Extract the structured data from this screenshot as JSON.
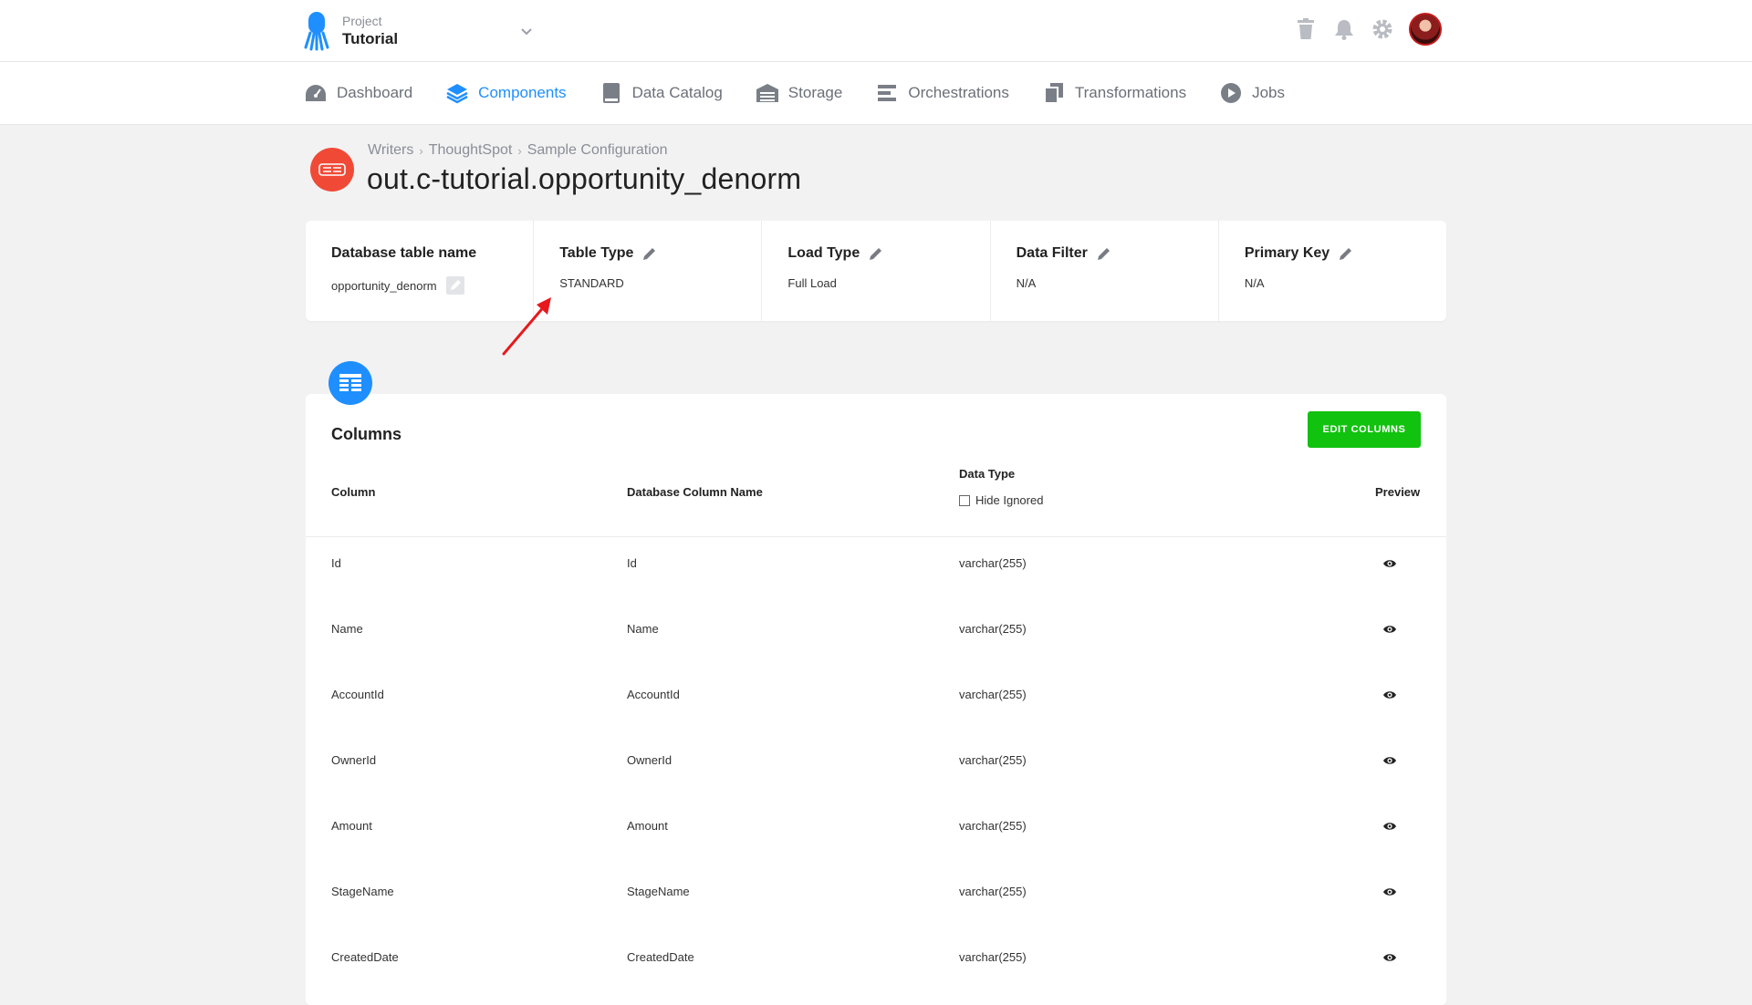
{
  "project": {
    "label": "Project",
    "name": "Tutorial"
  },
  "nav": [
    {
      "label": "Dashboard",
      "icon": "gauge-icon"
    },
    {
      "label": "Components",
      "icon": "layers-icon",
      "active": true
    },
    {
      "label": "Data Catalog",
      "icon": "book-icon"
    },
    {
      "label": "Storage",
      "icon": "warehouse-icon"
    },
    {
      "label": "Orchestrations",
      "icon": "bars-icon"
    },
    {
      "label": "Transformations",
      "icon": "copy-icon"
    },
    {
      "label": "Jobs",
      "icon": "play-circle-icon"
    }
  ],
  "breadcrumb": [
    "Writers",
    "ThoughtSpot",
    "Sample Configuration"
  ],
  "title": "out.c-tutorial.opportunity_denorm",
  "details": [
    {
      "heading": "Database table name",
      "value": "opportunity_denorm"
    },
    {
      "heading": "Table Type",
      "value": "STANDARD"
    },
    {
      "heading": "Load Type",
      "value": "Full Load"
    },
    {
      "heading": "Data Filter",
      "value": "N/A"
    },
    {
      "heading": "Primary Key",
      "value": "N/A"
    }
  ],
  "columns": {
    "title": "Columns",
    "edit_label": "EDIT COLUMNS",
    "headers": {
      "column": "Column",
      "db_column": "Database Column Name",
      "data_type": "Data Type",
      "hide_ignored": "Hide Ignored",
      "preview": "Preview"
    },
    "rows": [
      {
        "column": "Id",
        "db": "Id",
        "type": "varchar(255)"
      },
      {
        "column": "Name",
        "db": "Name",
        "type": "varchar(255)"
      },
      {
        "column": "AccountId",
        "db": "AccountId",
        "type": "varchar(255)"
      },
      {
        "column": "OwnerId",
        "db": "OwnerId",
        "type": "varchar(255)"
      },
      {
        "column": "Amount",
        "db": "Amount",
        "type": "varchar(255)"
      },
      {
        "column": "StageName",
        "db": "StageName",
        "type": "varchar(255)"
      },
      {
        "column": "CreatedDate",
        "db": "CreatedDate",
        "type": "varchar(255)"
      }
    ]
  },
  "colors": {
    "accent": "#1f8fff",
    "green": "#11c20f",
    "brand_red": "#f04a36",
    "annotation": "#e8191c"
  }
}
